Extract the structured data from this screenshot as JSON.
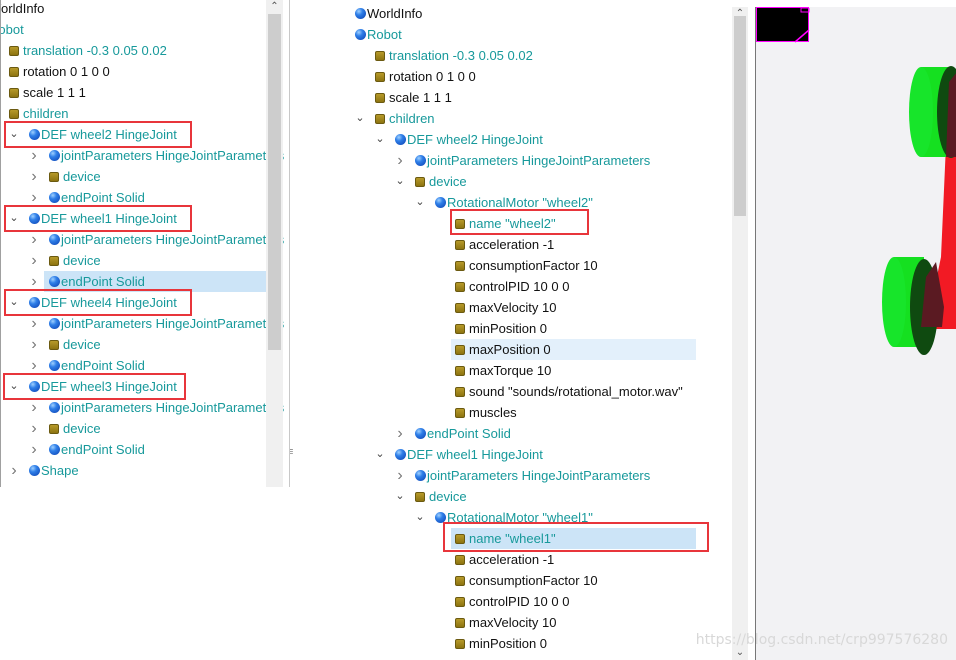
{
  "left_tree": {
    "rows": [
      {
        "label": "WorldInfo",
        "level": -1,
        "icon": "none",
        "arrow": "none",
        "color": "black"
      },
      {
        "label": "Robot",
        "level": -1,
        "icon": "none",
        "arrow": "none",
        "color": "teal"
      },
      {
        "label": "translation -0.3 0.05 0.02",
        "level": 0,
        "icon": "box",
        "arrow": "none",
        "color": "teal"
      },
      {
        "label": "rotation 0 1 0 0",
        "level": 0,
        "icon": "box",
        "arrow": "none",
        "color": "black"
      },
      {
        "label": "scale 1 1 1",
        "level": 0,
        "icon": "box",
        "arrow": "none",
        "color": "black"
      },
      {
        "label": "children",
        "level": 0,
        "icon": "box",
        "arrow": "none",
        "color": "teal"
      },
      {
        "label": "DEF wheel2 HingeJoint",
        "level": 1,
        "icon": "sphere",
        "arrow": "down",
        "color": "teal"
      },
      {
        "label": "jointParameters HingeJointParameters",
        "level": 2,
        "icon": "sphere",
        "arrow": "right",
        "color": "teal"
      },
      {
        "label": "device",
        "level": 2,
        "icon": "box",
        "arrow": "right",
        "color": "teal"
      },
      {
        "label": "endPoint Solid",
        "level": 2,
        "icon": "sphere",
        "arrow": "right",
        "color": "teal"
      },
      {
        "label": "DEF wheel1 HingeJoint",
        "level": 1,
        "icon": "sphere",
        "arrow": "down",
        "color": "teal"
      },
      {
        "label": "jointParameters HingeJointParameters",
        "level": 2,
        "icon": "sphere",
        "arrow": "right",
        "color": "teal"
      },
      {
        "label": "device",
        "level": 2,
        "icon": "box",
        "arrow": "right",
        "color": "teal"
      },
      {
        "label": "endPoint Solid",
        "level": 2,
        "icon": "sphere",
        "arrow": "right",
        "color": "teal",
        "selected": true
      },
      {
        "label": "DEF wheel4 HingeJoint",
        "level": 1,
        "icon": "sphere",
        "arrow": "down",
        "color": "teal"
      },
      {
        "label": "jointParameters HingeJointParameters",
        "level": 2,
        "icon": "sphere",
        "arrow": "right",
        "color": "teal"
      },
      {
        "label": "device",
        "level": 2,
        "icon": "box",
        "arrow": "right",
        "color": "teal"
      },
      {
        "label": "endPoint Solid",
        "level": 2,
        "icon": "sphere",
        "arrow": "right",
        "color": "teal"
      },
      {
        "label": "DEF wheel3 HingeJoint",
        "level": 1,
        "icon": "sphere",
        "arrow": "down",
        "color": "teal"
      },
      {
        "label": "jointParameters HingeJointParameters",
        "level": 2,
        "icon": "sphere",
        "arrow": "right",
        "color": "teal"
      },
      {
        "label": "device",
        "level": 2,
        "icon": "box",
        "arrow": "right",
        "color": "teal"
      },
      {
        "label": "endPoint Solid",
        "level": 2,
        "icon": "sphere",
        "arrow": "right",
        "color": "teal"
      },
      {
        "label": "Shape",
        "level": 1,
        "icon": "sphere",
        "arrow": "right",
        "color": "teal"
      }
    ]
  },
  "right_tree": {
    "rows": [
      {
        "label": "WorldInfo",
        "level": 0,
        "icon": "sphere",
        "arrow": "none",
        "color": "black"
      },
      {
        "label": "Robot",
        "level": 0,
        "icon": "sphere",
        "arrow": "none",
        "color": "teal"
      },
      {
        "label": "translation -0.3 0.05 0.02",
        "level": 1,
        "icon": "box",
        "arrow": "none",
        "color": "teal"
      },
      {
        "label": "rotation 0 1 0 0",
        "level": 1,
        "icon": "box",
        "arrow": "none",
        "color": "black"
      },
      {
        "label": "scale 1 1 1",
        "level": 1,
        "icon": "box",
        "arrow": "none",
        "color": "black"
      },
      {
        "label": "children",
        "level": 1,
        "icon": "box",
        "arrow": "down",
        "color": "teal"
      },
      {
        "label": "DEF wheel2 HingeJoint",
        "level": 2,
        "icon": "sphere",
        "arrow": "down",
        "color": "teal"
      },
      {
        "label": "jointParameters HingeJointParameters",
        "level": 3,
        "icon": "sphere",
        "arrow": "right",
        "color": "teal"
      },
      {
        "label": "device",
        "level": 3,
        "icon": "box",
        "arrow": "down",
        "color": "teal"
      },
      {
        "label": "RotationalMotor \"wheel2\"",
        "level": 4,
        "icon": "sphere",
        "arrow": "down",
        "color": "teal"
      },
      {
        "label": "name \"wheel2\"",
        "level": 5,
        "icon": "box",
        "arrow": "none",
        "color": "teal"
      },
      {
        "label": "acceleration -1",
        "level": 5,
        "icon": "box",
        "arrow": "none",
        "color": "black"
      },
      {
        "label": "consumptionFactor 10",
        "level": 5,
        "icon": "box",
        "arrow": "none",
        "color": "black"
      },
      {
        "label": "controlPID 10 0 0",
        "level": 5,
        "icon": "box",
        "arrow": "none",
        "color": "black"
      },
      {
        "label": "maxVelocity 10",
        "level": 5,
        "icon": "box",
        "arrow": "none",
        "color": "black"
      },
      {
        "label": "minPosition 0",
        "level": 5,
        "icon": "box",
        "arrow": "none",
        "color": "black"
      },
      {
        "label": "maxPosition 0",
        "level": 5,
        "icon": "box",
        "arrow": "none",
        "color": "black",
        "hover": true
      },
      {
        "label": "maxTorque 10",
        "level": 5,
        "icon": "box",
        "arrow": "none",
        "color": "black"
      },
      {
        "label": "sound \"sounds/rotational_motor.wav\"",
        "level": 5,
        "icon": "box",
        "arrow": "none",
        "color": "black"
      },
      {
        "label": "muscles",
        "level": 5,
        "icon": "box",
        "arrow": "none",
        "color": "black"
      },
      {
        "label": "endPoint Solid",
        "level": 3,
        "icon": "sphere",
        "arrow": "right",
        "color": "teal"
      },
      {
        "label": "DEF wheel1 HingeJoint",
        "level": 2,
        "icon": "sphere",
        "arrow": "down",
        "color": "teal"
      },
      {
        "label": "jointParameters HingeJointParameters",
        "level": 3,
        "icon": "sphere",
        "arrow": "right",
        "color": "teal"
      },
      {
        "label": "device",
        "level": 3,
        "icon": "box",
        "arrow": "down",
        "color": "teal"
      },
      {
        "label": "RotationalMotor \"wheel1\"",
        "level": 4,
        "icon": "sphere",
        "arrow": "down",
        "color": "teal"
      },
      {
        "label": "name \"wheel1\"",
        "level": 5,
        "icon": "box",
        "arrow": "none",
        "color": "teal",
        "selected": true
      },
      {
        "label": "acceleration -1",
        "level": 5,
        "icon": "box",
        "arrow": "none",
        "color": "black"
      },
      {
        "label": "consumptionFactor 10",
        "level": 5,
        "icon": "box",
        "arrow": "none",
        "color": "black"
      },
      {
        "label": "controlPID 10 0 0",
        "level": 5,
        "icon": "box",
        "arrow": "none",
        "color": "black"
      },
      {
        "label": "maxVelocity 10",
        "level": 5,
        "icon": "box",
        "arrow": "none",
        "color": "black"
      },
      {
        "label": "minPosition 0",
        "level": 5,
        "icon": "box",
        "arrow": "none",
        "color": "black"
      }
    ]
  },
  "colors": {
    "teal": "#17999b",
    "highlight": "#e8353b",
    "wheel": "#22e82a",
    "body": "#f21a24"
  },
  "watermark": "https://blog.csdn.net/crp997576280"
}
